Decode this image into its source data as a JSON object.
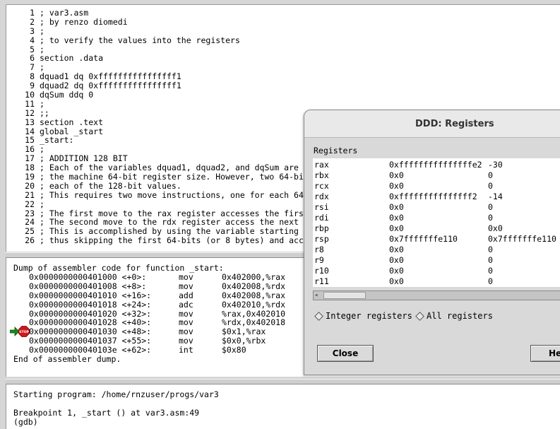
{
  "source": {
    "lines": [
      {
        "n": "1",
        "text": "; var3.asm"
      },
      {
        "n": "2",
        "text": "; by renzo diomedi"
      },
      {
        "n": "3",
        "text": ";"
      },
      {
        "n": "4",
        "text": "; to verify the values into the registers"
      },
      {
        "n": "5",
        "text": ";"
      },
      {
        "n": "6",
        "text": "section .data"
      },
      {
        "n": "7",
        "text": ";"
      },
      {
        "n": "8",
        "text": "dquad1 dq 0xffffffffffffffff1"
      },
      {
        "n": "9",
        "text": "dquad2 dq 0xffffffffffffffff1"
      },
      {
        "n": "10",
        "text": "dqSum ddq 0"
      },
      {
        "n": "11",
        "text": ";"
      },
      {
        "n": "12",
        "text": ";;"
      },
      {
        "n": "13",
        "text": "section .text"
      },
      {
        "n": "14",
        "text": "global _start"
      },
      {
        "n": "15",
        "text": "_start:"
      },
      {
        "n": "16",
        "text": ";"
      },
      {
        "n": "17",
        "text": "; ADDITION 128 BIT"
      },
      {
        "n": "18",
        "text": "; Each of the variables dquad1, dquad2, and dqSum are"
      },
      {
        "n": "19",
        "text": "; the machine 64-bit register size. However, two 64-bi"
      },
      {
        "n": "20",
        "text": "; each of the 128-bit values."
      },
      {
        "n": "21",
        "text": "; This requires two move instructions, one for each 64"
      },
      {
        "n": "22",
        "text": ";"
      },
      {
        "n": "23",
        "text": "; The first move to the rax register accesses the firs"
      },
      {
        "n": "24",
        "text": "; The second move to the rdx register access the next"
      },
      {
        "n": "25",
        "text": "; This is accomplished by using the variable starting"
      },
      {
        "n": "26",
        "text": "; thus skipping the first 64-bits (or 8 bytes) and acc"
      }
    ]
  },
  "asm": {
    "header": "Dump of assembler code for function _start:",
    "rows": [
      {
        "addr": "0x0000000000401000 <+0>:",
        "mnemonic": "mov",
        "operands": "0x402000,%rax"
      },
      {
        "addr": "0x0000000000401008 <+8>:",
        "mnemonic": "mov",
        "operands": "0x402008,%rdx"
      },
      {
        "addr": "0x0000000000401010 <+16>:",
        "mnemonic": "add",
        "operands": "0x402008,%rax"
      },
      {
        "addr": "0x0000000000401018 <+24>:",
        "mnemonic": "adc",
        "operands": "0x402010,%rdx"
      },
      {
        "addr": "0x0000000000401020 <+32>:",
        "mnemonic": "mov",
        "operands": "%rax,0x402010"
      },
      {
        "addr": "0x0000000000401028 <+40>:",
        "mnemonic": "mov",
        "operands": "%rdx,0x402018"
      },
      {
        "addr": "0x0000000000401030 <+48>:",
        "mnemonic": "mov",
        "operands": "$0x1,%rax"
      },
      {
        "addr": "0x0000000000401037 <+55>:",
        "mnemonic": "mov",
        "operands": "$0x0,%rbx"
      },
      {
        "addr": "0x000000000040103e <+62>:",
        "mnemonic": "int",
        "operands": "$0x80"
      }
    ],
    "footer": "End of assembler dump.",
    "breakpoint_row": 6,
    "stop_label": "STOP"
  },
  "console": {
    "lines": [
      "Starting program: /home/rnzuser/progs/var3",
      "",
      "Breakpoint 1, _start () at var3.asm:49",
      "(gdb)"
    ]
  },
  "registers_dialog": {
    "title": "DDD: Registers",
    "section_label": "Registers",
    "rows": [
      {
        "name": "rax",
        "hex": "0xfffffffffffffffe2",
        "natural": "-30"
      },
      {
        "name": "rbx",
        "hex": "0x0",
        "natural": "0"
      },
      {
        "name": "rcx",
        "hex": "0x0",
        "natural": "0"
      },
      {
        "name": "rdx",
        "hex": "0xfffffffffffffff2",
        "natural": "-14"
      },
      {
        "name": "rsi",
        "hex": "0x0",
        "natural": "0"
      },
      {
        "name": "rdi",
        "hex": "0x0",
        "natural": "0"
      },
      {
        "name": "rbp",
        "hex": "0x0",
        "natural": "0x0"
      },
      {
        "name": "rsp",
        "hex": "0x7fffffffe110",
        "natural": "0x7fffffffe110"
      },
      {
        "name": "r8",
        "hex": "0x0",
        "natural": "0"
      },
      {
        "name": "r9",
        "hex": "0x0",
        "natural": "0"
      },
      {
        "name": "r10",
        "hex": "0x0",
        "natural": "0"
      },
      {
        "name": "r11",
        "hex": "0x0",
        "natural": "0"
      }
    ],
    "radio_integer": "Integer registers",
    "radio_all": "All registers",
    "close_label": "Close",
    "help_label": "He"
  }
}
